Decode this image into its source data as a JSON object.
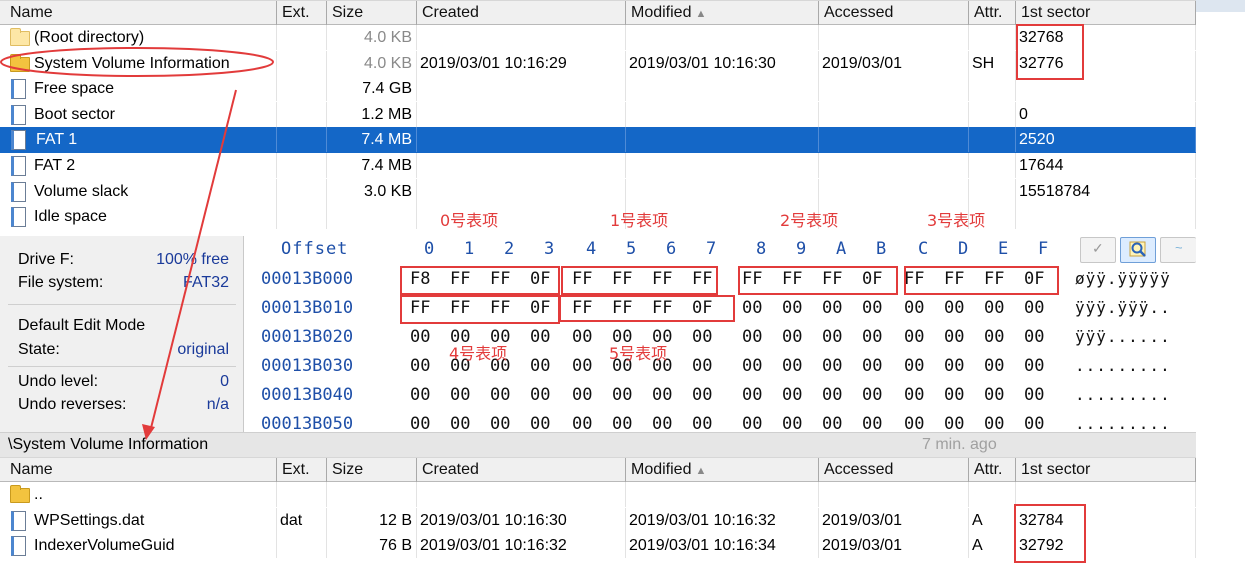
{
  "columns": {
    "name": "Name",
    "ext": "Ext.",
    "size": "Size",
    "created": "Created",
    "modified": "Modified",
    "accessed": "Accessed",
    "attr": "Attr.",
    "first_sector": "1st sector"
  },
  "top_list": [
    {
      "name": "(Root directory)",
      "size": "4.0 KB",
      "first_sector": "32768"
    },
    {
      "name": "System Volume Information",
      "size": "4.0 KB",
      "created": "2019/03/01  10:16:29",
      "modified": "2019/03/01  10:16:30",
      "accessed": "2019/03/01",
      "attr": "SH",
      "first_sector": "32776"
    },
    {
      "name": "Free space",
      "size": "7.4 GB"
    },
    {
      "name": "Boot sector",
      "size": "1.2 MB",
      "first_sector": "0"
    },
    {
      "name": "FAT 1",
      "size": "7.4 MB",
      "first_sector": "2520"
    },
    {
      "name": "FAT 2",
      "size": "7.4 MB",
      "first_sector": "17644"
    },
    {
      "name": "Volume slack",
      "size": "3.0 KB",
      "first_sector": "15518784"
    },
    {
      "name": "Idle space"
    }
  ],
  "info_panel": {
    "drive_label": "Drive F:",
    "drive_free": "100% free",
    "fs_label": "File system:",
    "fs_value": "FAT32",
    "edit_mode": "Default Edit Mode",
    "state_label": "State:",
    "state_value": "original",
    "undo_level_label": "Undo level:",
    "undo_level_value": "0",
    "undo_rev_label": "Undo reverses:",
    "undo_rev_value": "n/a"
  },
  "hex": {
    "offset_label": "Offset",
    "col_headers": [
      "0",
      "1",
      "2",
      "3",
      "4",
      "5",
      "6",
      "7",
      "8",
      "9",
      "A",
      "B",
      "C",
      "D",
      "E",
      "F"
    ],
    "rows": [
      {
        "offset": "00013B000",
        "bytes": [
          "F8",
          "FF",
          "FF",
          "0F",
          "FF",
          "FF",
          "FF",
          "FF",
          "FF",
          "FF",
          "FF",
          "0F",
          "FF",
          "FF",
          "FF",
          "0F"
        ],
        "ascii": "øÿÿ.ÿÿÿÿÿ"
      },
      {
        "offset": "00013B010",
        "bytes": [
          "FF",
          "FF",
          "FF",
          "0F",
          "FF",
          "FF",
          "FF",
          "0F",
          "00",
          "00",
          "00",
          "00",
          "00",
          "00",
          "00",
          "00"
        ],
        "ascii": "ÿÿÿ.ÿÿÿ.."
      },
      {
        "offset": "00013B020",
        "bytes": [
          "00",
          "00",
          "00",
          "00",
          "00",
          "00",
          "00",
          "00",
          "00",
          "00",
          "00",
          "00",
          "00",
          "00",
          "00",
          "00"
        ],
        "ascii": "ÿÿÿ......"
      },
      {
        "offset": "00013B030",
        "bytes": [
          "00",
          "00",
          "00",
          "00",
          "00",
          "00",
          "00",
          "00",
          "00",
          "00",
          "00",
          "00",
          "00",
          "00",
          "00",
          "00"
        ],
        "ascii": "........."
      },
      {
        "offset": "00013B040",
        "bytes": [
          "00",
          "00",
          "00",
          "00",
          "00",
          "00",
          "00",
          "00",
          "00",
          "00",
          "00",
          "00",
          "00",
          "00",
          "00",
          "00"
        ],
        "ascii": "........."
      },
      {
        "offset": "00013B050",
        "bytes": [
          "00",
          "00",
          "00",
          "00",
          "00",
          "00",
          "00",
          "00",
          "00",
          "00",
          "00",
          "00",
          "00",
          "00",
          "00",
          "00"
        ],
        "ascii": "........."
      }
    ],
    "annotations": [
      "0号表项",
      "1号表项",
      "2号表项",
      "3号表项",
      "4号表项",
      "5号表项"
    ]
  },
  "path_bar": {
    "path": "\\System Volume Information",
    "age": "7 min. ago"
  },
  "bottom_list": [
    {
      "name": ".."
    },
    {
      "name": "WPSettings.dat",
      "ext": "dat",
      "size": "12 B",
      "created": "2019/03/01  10:16:30",
      "modified": "2019/03/01  10:16:32",
      "accessed": "2019/03/01",
      "attr": "A",
      "first_sector": "32784"
    },
    {
      "name": "IndexerVolumeGuid",
      "size": "76 B",
      "created": "2019/03/01  10:16:32",
      "modified": "2019/03/01  10:16:34",
      "accessed": "2019/03/01",
      "attr": "A",
      "first_sector": "32792"
    }
  ],
  "icons": {
    "folder": "folder-icon",
    "file": "file-icon",
    "sort": "sort-ascending-icon",
    "check": "check-icon",
    "search": "search-icon"
  },
  "colors": {
    "selection": "#1467c7",
    "annotation": "#e23b3b",
    "hex_blue": "#1e4fa8"
  }
}
